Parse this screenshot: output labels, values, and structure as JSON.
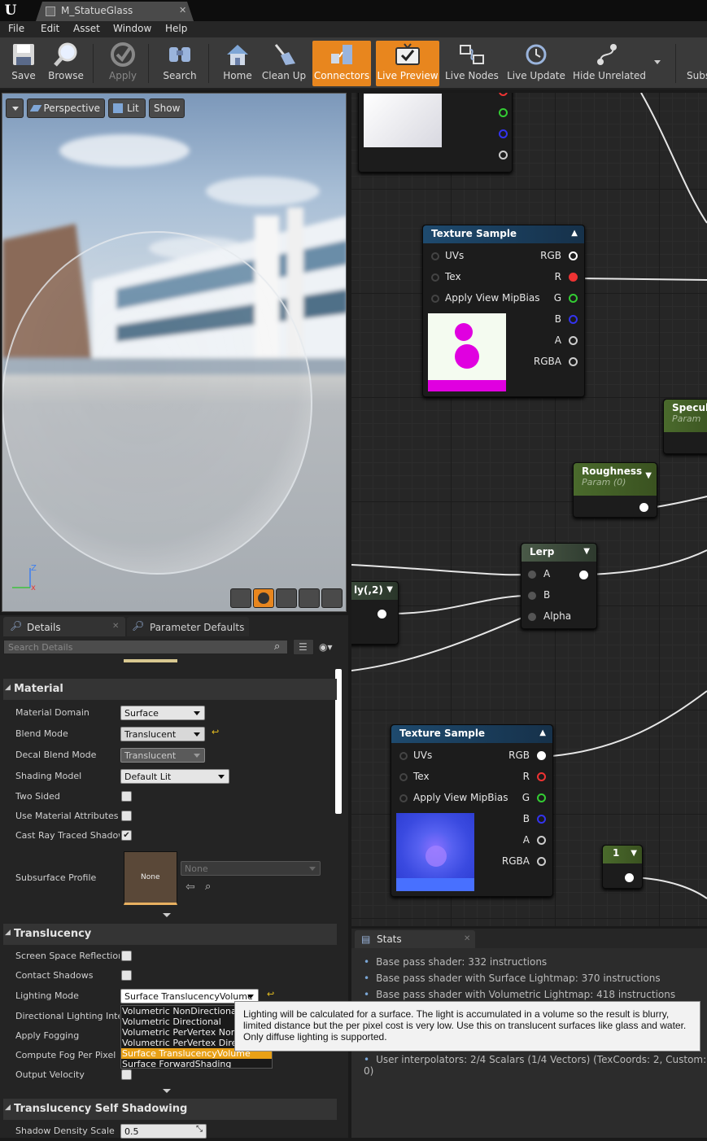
{
  "window": {
    "doc_tab": "M_StatueGlass"
  },
  "menu": [
    "File",
    "Edit",
    "Asset",
    "Window",
    "Help"
  ],
  "toolbar": {
    "save": "Save",
    "browse": "Browse",
    "apply": "Apply",
    "search": "Search",
    "home": "Home",
    "cleanup": "Clean Up",
    "connectors": "Connectors",
    "live_preview": "Live Preview",
    "live_nodes": "Live Nodes",
    "live_update": "Live Update",
    "hide_unrelated": "Hide Unrelated",
    "subs": "Subs"
  },
  "viewport": {
    "perspective": "Perspective",
    "lit": "Lit",
    "show": "Show",
    "axis_z": "Z"
  },
  "tabs": {
    "details": "Details",
    "parameter_defaults": "Parameter Defaults"
  },
  "search": {
    "placeholder": "Search Details"
  },
  "material": {
    "section": "Material",
    "domain_label": "Material Domain",
    "domain_value": "Surface",
    "blend_label": "Blend Mode",
    "blend_value": "Translucent",
    "decal_label": "Decal Blend Mode",
    "decal_value": "Translucent",
    "shading_label": "Shading Model",
    "shading_value": "Default Lit",
    "two_sided_label": "Two Sided",
    "use_attr_label": "Use Material Attributes",
    "cast_ray_label": "Cast Ray Traced Shadows",
    "subsurface_label": "Subsurface Profile",
    "subsurface_thumb": "None",
    "subsurface_value": "None"
  },
  "translucency": {
    "section": "Translucency",
    "ssr_label": "Screen Space Reflections",
    "contact_label": "Contact Shadows",
    "lighting_label": "Lighting Mode",
    "lighting_value": "Surface TranslucencyVolume",
    "dir_label": "Directional Lighting Intensity",
    "fog_label": "Apply Fogging",
    "compute_fog_label": "Compute Fog Per Pixel",
    "velocity_label": "Output Velocity",
    "options": [
      "Volumetric NonDirectional",
      "Volumetric Directional",
      "Volumetric PerVertex NonDirectional",
      "Volumetric PerVertex Directional",
      "Surface TranslucencyVolume",
      "Surface ForwardShading"
    ],
    "tooltip": "Lighting will be calculated for a surface. The light is accumulated in a volume so the result is blurry, limited distance but the per pixel cost is very low. Use this on translucent surfaces like glass and water. Only diffuse lighting is supported."
  },
  "self_shadow": {
    "section": "Translucency Self Shadowing",
    "density_label": "Shadow Density Scale",
    "density_value": "0.5"
  },
  "graph": {
    "tex1": {
      "title": "Texture Sample",
      "in": [
        "UVs",
        "Tex",
        "Apply View MipBias"
      ],
      "out": [
        "RGB",
        "R",
        "G",
        "B",
        "A",
        "RGBA"
      ]
    },
    "tex2": {
      "title": "Texture Sample",
      "in": [
        "UVs",
        "Tex",
        "Apply View MipBias"
      ],
      "out": [
        "RGB",
        "R",
        "G",
        "B",
        "A",
        "RGBA"
      ]
    },
    "specular": {
      "title": "Specul",
      "sub": "Param"
    },
    "roughness": {
      "title": "Roughness",
      "sub": "Param (0)"
    },
    "lerp": {
      "title": "Lerp",
      "in": [
        "A",
        "B",
        "Alpha"
      ]
    },
    "partial": {
      "title": "ly(,2)"
    },
    "const": {
      "title": "1"
    }
  },
  "stats": {
    "tab": "Stats",
    "lines": [
      "Base pass shader: 332 instructions",
      "Base pass shader with Surface Lightmap: 370 instructions",
      "Base pass shader with Volumetric Lightmap: 418 instructions",
      "User interpolators: 2/4 Scalars (1/4 Vectors) (TexCoords: 2, Custom: 0)"
    ]
  },
  "colors": {
    "accent": "#e8861e",
    "node_header_blue": "#1e4a6e",
    "node_header_green": "#4a6a2c",
    "selected": "#e8a016"
  }
}
